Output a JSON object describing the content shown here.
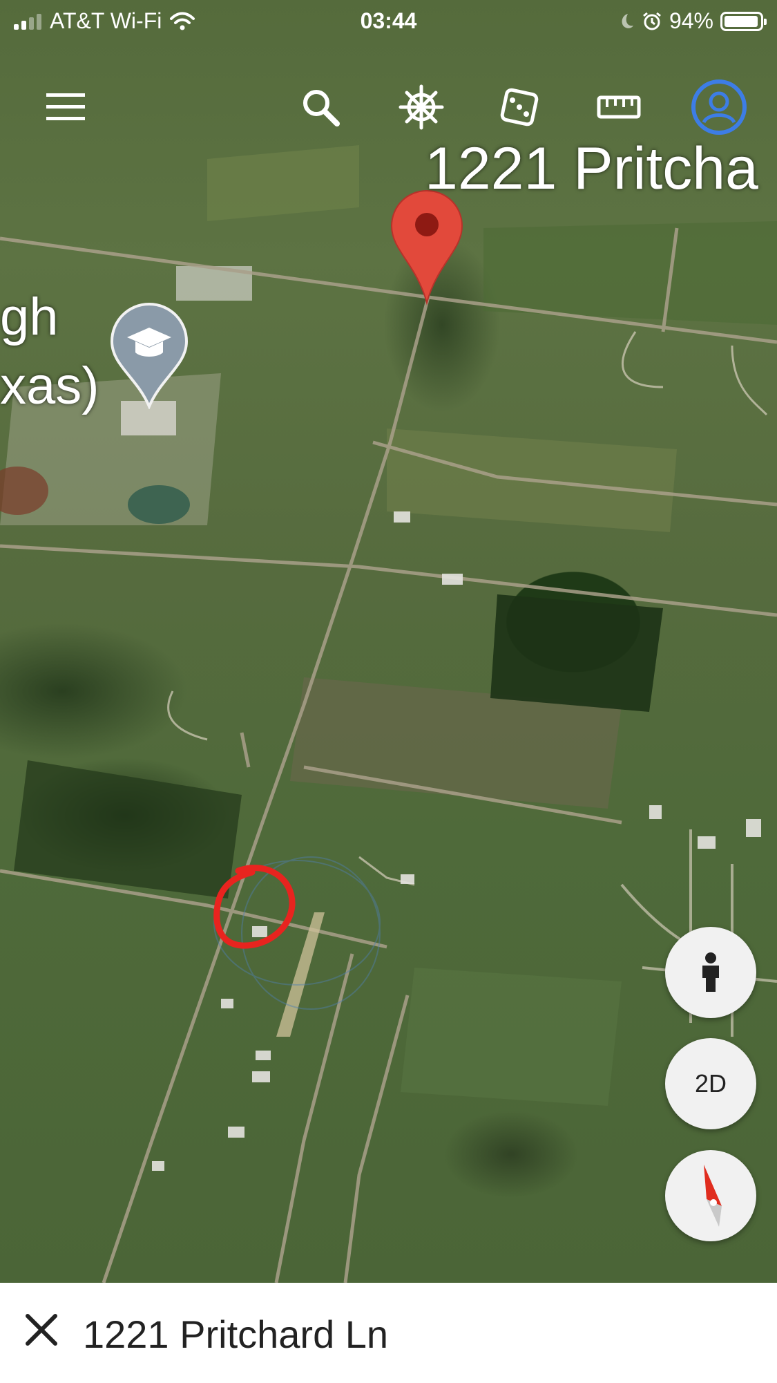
{
  "status_bar": {
    "carrier": "AT&T Wi-Fi",
    "time": "03:44",
    "battery": "94%"
  },
  "toolbar": {
    "icons": [
      "menu-icon",
      "search-icon",
      "voyager-wheel-icon",
      "dice-icon",
      "ruler-icon",
      "account-icon"
    ]
  },
  "map": {
    "place_label": "1221 Pritcha",
    "poi_label_line1": "gh",
    "poi_label_line2": "xas)"
  },
  "controls": {
    "view_mode": "2D"
  },
  "bottom_bar": {
    "address": "1221 Pritchard Ln"
  },
  "colors": {
    "pin_red": "#e2493b",
    "account_blue": "#3d7de6",
    "poi_gray": "#8a9aa8",
    "annotation_red": "#e8241f"
  }
}
